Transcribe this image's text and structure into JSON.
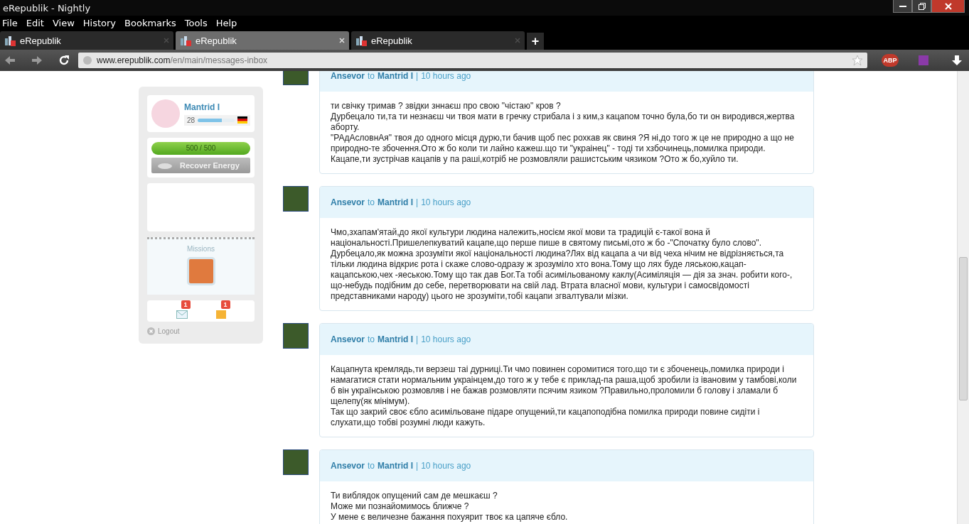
{
  "window": {
    "title": "eRepublik - Nightly"
  },
  "menu": [
    "File",
    "Edit",
    "View",
    "History",
    "Bookmarks",
    "Tools",
    "Help"
  ],
  "tabs": [
    {
      "label": "eRepublik",
      "selected": false
    },
    {
      "label": "eRepublik",
      "selected": true
    },
    {
      "label": "eRepublik",
      "selected": false
    }
  ],
  "new_tab": "+",
  "address": {
    "host": "www.erepublik.com",
    "path": "/en/main/messages-inbox"
  },
  "adblock": "ABP",
  "sidebar": {
    "name": "Mantrid I",
    "level_label": "28",
    "xp": {
      "level": 0.65
    },
    "energy": {
      "reading": "500 / 500",
      "level": 1.0
    },
    "recover": "Recover Energy",
    "missions": "Missions",
    "badges": [
      "1",
      "1"
    ],
    "logout": "Logout"
  },
  "messages": [
    {
      "author": "Ansevor",
      "to": "to",
      "recipient": "Mantrid I",
      "separator": "|",
      "time": "10 hours ago",
      "paragraphs": [
        "ти свічку тримав ? звідки зннаєш про свою \"чістаю\" кров ?",
        "Дурбецало ти,та ти незнаєш чи твоя мати в гречку стрибала і з ким,з кацапом точно була,бо ти он виродився,жертва аборту.",
        "\"РАдАсловнАя\" твоя до одного місця дурю,ти бачив щоб пес рохкав як свиня ?Я ні,до того ж це не природно а що не природно-те збочення.Ото ж бо коли ти лайно кажеш.що ти \"украінец\" - тоді ти хзбочинець,помилка природи.",
        "Кацапе,ти зустрічав кацапів у па раші,котріб не розмовляли рашистським чязиком ?Ото ж бо,хуйло ти."
      ]
    },
    {
      "author": "Ansevor",
      "to": "to",
      "recipient": "Mantrid I",
      "separator": "|",
      "time": "10 hours ago",
      "paragraphs": [
        "Чмо,зхапам'ятай,до якої культури людина належить,носієм якої мови та традицій є-такої вона й національності.Пришелепкуватий кацапе,що перше пише в святому письмі,ото ж бо -\"Спочатку було слово\". Дурбецало,як можна зрозуміти якої національності людина?Лях від кацапа а чи від чеха нічим не відрізняється,та тільки людина відкриє рота і скаже слово-одразу ж зрозуміло хто вона.Тому що лях буде ляською,кацап-кацапською,чех -яеською.Тому що так дав Бог.Та тобі асимільованому каклу(Асиміляція — дія за знач. робити кого-, що-небудь подібним до себе, перетворювати на свій лад. Втрата власної мови, культури і самосвідомості представниками народу) цього не зрозуміти,тобі кацапи згвалтували мізки."
      ]
    },
    {
      "author": "Ansevor",
      "to": "to",
      "recipient": "Mantrid I",
      "separator": "|",
      "time": "10 hours ago",
      "paragraphs": [
        "Кацапнута кремлядь,ти верзеш таі дурниці.Ти чмо повинен соромитися того,що ти є збоченець,помилка природи і намагатися стати нормальним украінцем,до того ж у тебе є приклад-па раша,щоб зробили із івановим у тамбові,коли б він українською розмовляв і не бажав розмовляти псячим язиком ?Правильно,проломили б голову і зламали б щелепу(як мінімум).",
        "Так що закрий своє єбло асимільоване підаре опущений,ти кацапоподібна помилка природи повине сидіти і слухати,що тобві розумні люди кажуть."
      ]
    },
    {
      "author": "Ansevor",
      "to": "to",
      "recipient": "Mantrid I",
      "separator": "|",
      "time": "10 hours ago",
      "paragraphs": [
        "Ти виблядок опущений сам де мешкаєш ?",
        "Може ми познайомимось ближче ?",
        "У мене є величезне бажання похуярит твоє ка цапяче єбло."
      ]
    }
  ]
}
